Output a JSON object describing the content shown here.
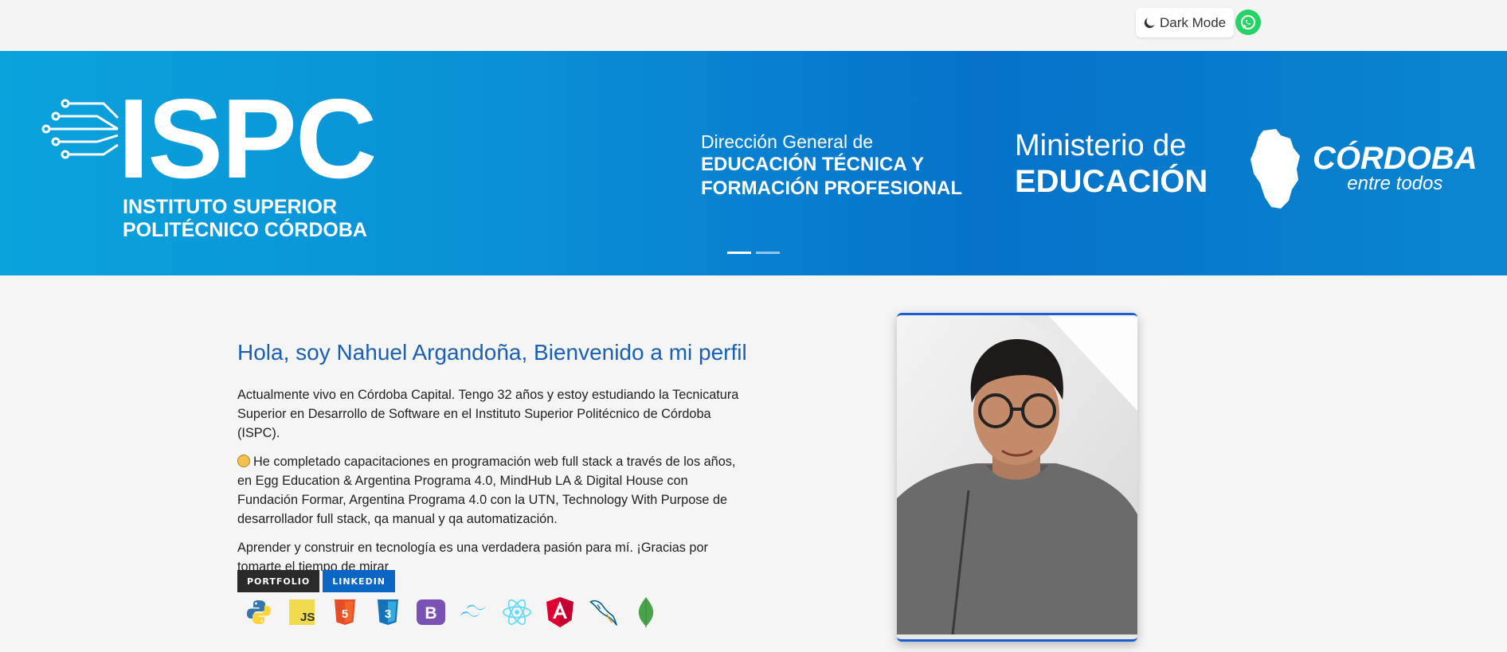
{
  "header": {
    "dark_mode_label": "Dark Mode",
    "icons": [
      "moon-icon",
      "whatsapp-icon"
    ]
  },
  "banner": {
    "ispc_title": "ISPC",
    "ispc_subtitle_1": "INSTITUTO SUPERIOR",
    "ispc_subtitle_2": "POLITÉCNICO CÓRDOBA",
    "dg_line1": "Dirección General de",
    "dg_line2": "EDUCACIÓN TÉCNICA Y",
    "dg_line3": "FORMACIÓN PROFESIONAL",
    "ministerio_line1": "Ministerio de",
    "ministerio_line2": "EDUCACIÓN",
    "cordoba_title": "CÓRDOBA",
    "cordoba_sub": "entre todos",
    "slides_total": 2,
    "active_slide": 1
  },
  "intro": {
    "title": "Hola, soy Nahuel Argandoña, Bienvenido a mi perfil",
    "paragraph1": "Actualmente vivo en Córdoba Capital. Tengo 32 años y estoy estudiando la Tecnicatura Superior en Desarrollo de Software en el Instituto Superior Politécnico de Córdoba (ISPC).",
    "paragraph2": "He completado capacitaciones en programación web full stack a través de los años, en Egg Education & Argentina Programa 4.0, MindHub LA & Digital House con Fundación Formar, Argentina Programa 4.0 con la UTN, Technology With Purpose de desarrollador full stack, qa manual y qa automatización.",
    "paragraph3": "Aprender y construir en tecnología es una verdadera pasión para mí. ¡Gracias por tomarte el tiempo de mirar"
  },
  "badges": {
    "portfolio": "PORTFOLIO",
    "linkedin": "LINKEDIN"
  },
  "tech_icons": [
    "python-icon",
    "javascript-icon",
    "html5-icon",
    "css3-icon",
    "bootstrap-icon",
    "tailwind-icon",
    "react-icon",
    "angular-icon",
    "mysql-icon",
    "mongodb-icon"
  ],
  "colors": {
    "accent_blue": "#1a5fb4",
    "linkedin_blue": "#0a66c2",
    "whatsapp_green": "#25d366"
  }
}
